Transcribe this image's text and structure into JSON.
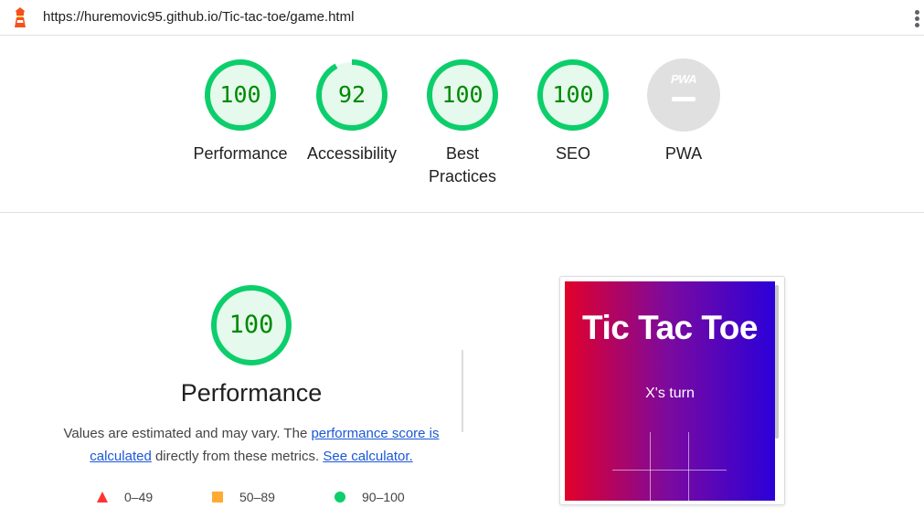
{
  "browser": {
    "url": "https://huremovic95.github.io/Tic-tac-toe/game.html"
  },
  "scores": [
    {
      "value": "100",
      "label": "Performance",
      "percent": 100
    },
    {
      "value": "92",
      "label": "Accessibility",
      "percent": 92
    },
    {
      "value": "100",
      "label": "Best Practices",
      "percent": 100
    },
    {
      "value": "100",
      "label": "SEO",
      "percent": 100
    },
    {
      "value": "",
      "label": "PWA",
      "badge_text": "PWA",
      "percent": 0
    }
  ],
  "performance": {
    "score": "100",
    "percent": 100,
    "title": "Performance",
    "desc_prefix": "Values are estimated and may vary. The ",
    "link_score_text": "performance score is calculated",
    "desc_middle": " directly from these metrics. ",
    "link_calc_text": "See calculator."
  },
  "legend": [
    {
      "range": "0–49",
      "color": "#ff3333",
      "shape": "triangle"
    },
    {
      "range": "50–89",
      "color": "#ffaa33",
      "shape": "square"
    },
    {
      "range": "90–100",
      "color": "#0cce6b",
      "shape": "circle"
    }
  ],
  "screenshot": {
    "title": "Tic Tac Toe",
    "status": "X's turn"
  },
  "colors": {
    "pass": "#0cce6b",
    "pass_bg": "#e5f9ed",
    "pass_text": "#008800",
    "na_bg": "#e0e0e0",
    "link": "#1a57d6"
  }
}
